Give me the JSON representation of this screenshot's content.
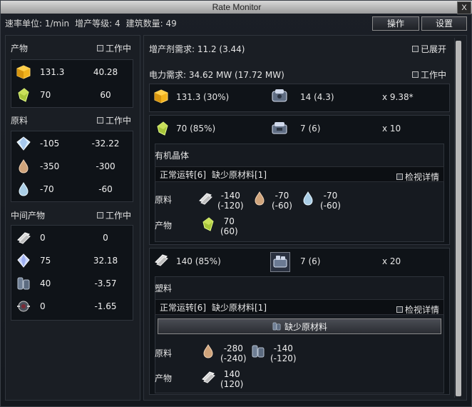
{
  "window": {
    "title": "Rate Monitor",
    "close_label": "X"
  },
  "topbar": {
    "rate_unit": "速率单位: 1/min",
    "proliferator_level": "增产等级: 4",
    "building_count": "建筑数量: 49",
    "buttons": {
      "operate": "操作",
      "settings": "设置"
    }
  },
  "left": {
    "products": {
      "title": "产物",
      "working_label": "工作中",
      "items": [
        {
          "icon": "yellow-cube-icon",
          "a": "131.3",
          "b": "40.28"
        },
        {
          "icon": "organic-crystal-icon",
          "a": "70",
          "b": "60"
        }
      ]
    },
    "materials": {
      "title": "原料",
      "working_label": "工作中",
      "items": [
        {
          "icon": "diamond-icon",
          "a": "-105",
          "b": "-32.22"
        },
        {
          "icon": "oil-drop-icon",
          "a": "-350",
          "b": "-300"
        },
        {
          "icon": "water-drop-icon",
          "a": "-70",
          "b": "-60"
        }
      ]
    },
    "intermediate": {
      "title": "中间产物",
      "working_label": "工作中",
      "items": [
        {
          "icon": "plastic-icon",
          "a": "0",
          "b": "0"
        },
        {
          "icon": "crystal-icon",
          "a": "75",
          "b": "32.18"
        },
        {
          "icon": "pipes-icon",
          "a": "40",
          "b": "-3.57"
        },
        {
          "icon": "machine-part-icon",
          "a": "0",
          "b": "-1.65"
        }
      ]
    }
  },
  "right": {
    "proliferator_demand": "增产剂需求: 11.2 (3.44)",
    "expanded_label": "已展开",
    "power_demand": "电力需求: 34.62 MW (17.72 MW)",
    "working_label": "工作中",
    "cards": [
      {
        "output": "131.3 (30%)",
        "machines": "14 (4.3)",
        "multiplier": "x 9.38*"
      },
      {
        "output": "70 (85%)",
        "machines": "7 (6)",
        "multiplier": "x 10",
        "recipe_title": "有机晶体",
        "status_normal": "正常运转[6]",
        "status_missing": "缺少原材料[1]",
        "detail_label": "检视详情",
        "materials_label": "原料",
        "products_label": "产物",
        "ingredients": [
          {
            "icon": "plastic-icon",
            "line1": "-140",
            "line2": "(-120)"
          },
          {
            "icon": "oil-drop-icon",
            "line1": "-70",
            "line2": "(-60)"
          },
          {
            "icon": "water-drop-icon",
            "line1": "-70",
            "line2": "(-60)"
          }
        ],
        "products": [
          {
            "icon": "organic-crystal-icon",
            "line1": "70",
            "line2": "(60)"
          }
        ]
      },
      {
        "output": "140 (85%)",
        "machines": "7 (6)",
        "multiplier": "x 20",
        "recipe_title": "塑料",
        "status_normal": "正常运转[6]",
        "status_missing": "缺少原材料[1]",
        "detail_label": "检视详情",
        "missing_button": "缺少原材料",
        "materials_label": "原料",
        "products_label": "产物",
        "ingredients": [
          {
            "icon": "oil-drop-icon",
            "line1": "-280",
            "line2": "(-240)"
          },
          {
            "icon": "pipes-icon",
            "line1": "-140",
            "line2": "(-120)"
          }
        ],
        "products": [
          {
            "icon": "plastic-icon",
            "line1": "140",
            "line2": "(120)"
          }
        ]
      }
    ]
  },
  "colors": {
    "yellow": "#f2b21c",
    "green": "#a8c53a",
    "panel": "#1a1e24",
    "box": "#0f1318"
  }
}
